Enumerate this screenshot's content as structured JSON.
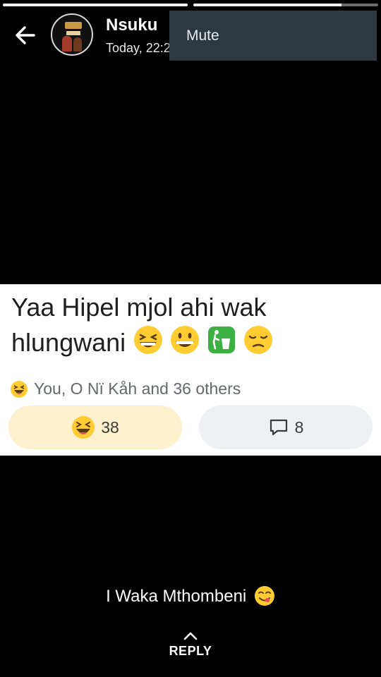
{
  "status": {
    "segments": [
      {
        "progress": 1.0
      },
      {
        "progress": 0.8
      }
    ]
  },
  "header": {
    "name": "Nsuku",
    "time": "Today, 22:2"
  },
  "menu": {
    "items": [
      "Mute"
    ]
  },
  "post": {
    "line1": "Yaa Hipel mjol ahi wak",
    "line2": "hlungwani",
    "emojis": [
      "grinning-squint-face",
      "grinning-face",
      "trash-can-sign",
      "pensive-face"
    ],
    "reactions_summary": "You, O Nï Kåh and 36 others",
    "reaction_count": "38",
    "comment_count": "8"
  },
  "caption": {
    "text": "I Waka Mthombeni",
    "emoji": "yum-face"
  },
  "reply": {
    "label": "REPLY"
  },
  "colors": {
    "react_button": "#fdf0cc",
    "comment_button": "#eef0f3",
    "menu_bg": "#2e3840"
  }
}
